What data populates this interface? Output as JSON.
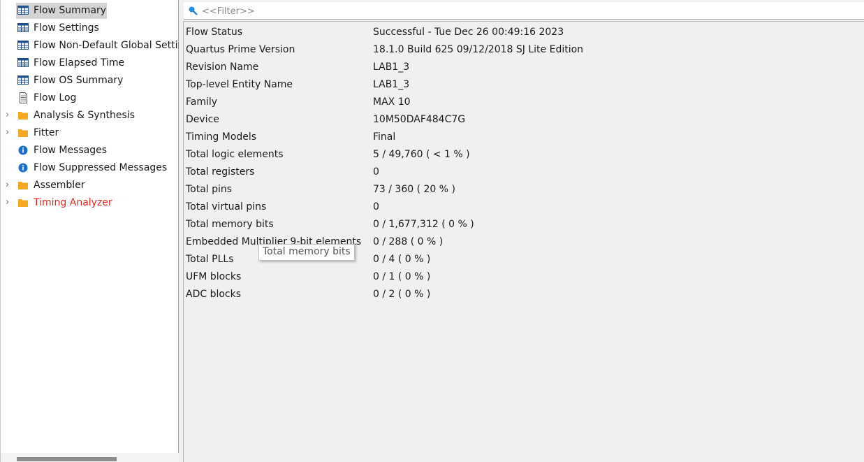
{
  "tree": {
    "items": [
      {
        "label": "Flow Summary",
        "icon": "table-icon"
      },
      {
        "label": "Flow Settings",
        "icon": "table-icon"
      },
      {
        "label": "Flow Non-Default Global Settings",
        "icon": "table-icon"
      },
      {
        "label": "Flow Elapsed Time",
        "icon": "table-icon"
      },
      {
        "label": "Flow OS Summary",
        "icon": "table-icon"
      },
      {
        "label": "Flow Log",
        "icon": "document-icon"
      },
      {
        "label": "Analysis & Synthesis",
        "icon": "folder-icon"
      },
      {
        "label": "Fitter",
        "icon": "folder-icon"
      },
      {
        "label": "Flow Messages",
        "icon": "info-icon"
      },
      {
        "label": "Flow Suppressed Messages",
        "icon": "info-icon"
      },
      {
        "label": "Assembler",
        "icon": "folder-icon"
      },
      {
        "label": "Timing Analyzer",
        "icon": "folder-icon"
      }
    ],
    "selected": "Flow Summary"
  },
  "filter": {
    "placeholder": "<<Filter>>"
  },
  "summary": {
    "rows": [
      {
        "key": "Flow Status",
        "value": "Successful - Tue Dec 26 00:49:16 2023"
      },
      {
        "key": "Quartus Prime Version",
        "value": "18.1.0 Build 625 09/12/2018 SJ Lite Edition"
      },
      {
        "key": "Revision Name",
        "value": "LAB1_3"
      },
      {
        "key": "Top-level Entity Name",
        "value": "LAB1_3"
      },
      {
        "key": "Family",
        "value": "MAX 10"
      },
      {
        "key": "Device",
        "value": "10M50DAF484C7G"
      },
      {
        "key": "Timing Models",
        "value": "Final"
      },
      {
        "key": "Total logic elements",
        "value": "5 / 49,760 ( < 1 % )"
      },
      {
        "key": "Total registers",
        "value": "0"
      },
      {
        "key": "Total pins",
        "value": "73 / 360 ( 20 % )"
      },
      {
        "key": "Total virtual pins",
        "value": "0"
      },
      {
        "key": "Total memory bits",
        "value": "0 / 1,677,312 ( 0 % )"
      },
      {
        "key": "Embedded Multiplier 9-bit elements",
        "value": "0 / 288 ( 0 % )"
      },
      {
        "key": "Total PLLs",
        "value": "0 / 4 ( 0 % )"
      },
      {
        "key": "UFM blocks",
        "value": "0 / 1 ( 0 % )"
      },
      {
        "key": "ADC blocks",
        "value": "0 / 2 ( 0 % )"
      }
    ]
  },
  "tooltip": {
    "text": "Total memory bits"
  },
  "colors": {
    "accent_blue": "#1f6fc5",
    "folder_orange": "#f5a623",
    "timing_red": "#e0271f"
  }
}
